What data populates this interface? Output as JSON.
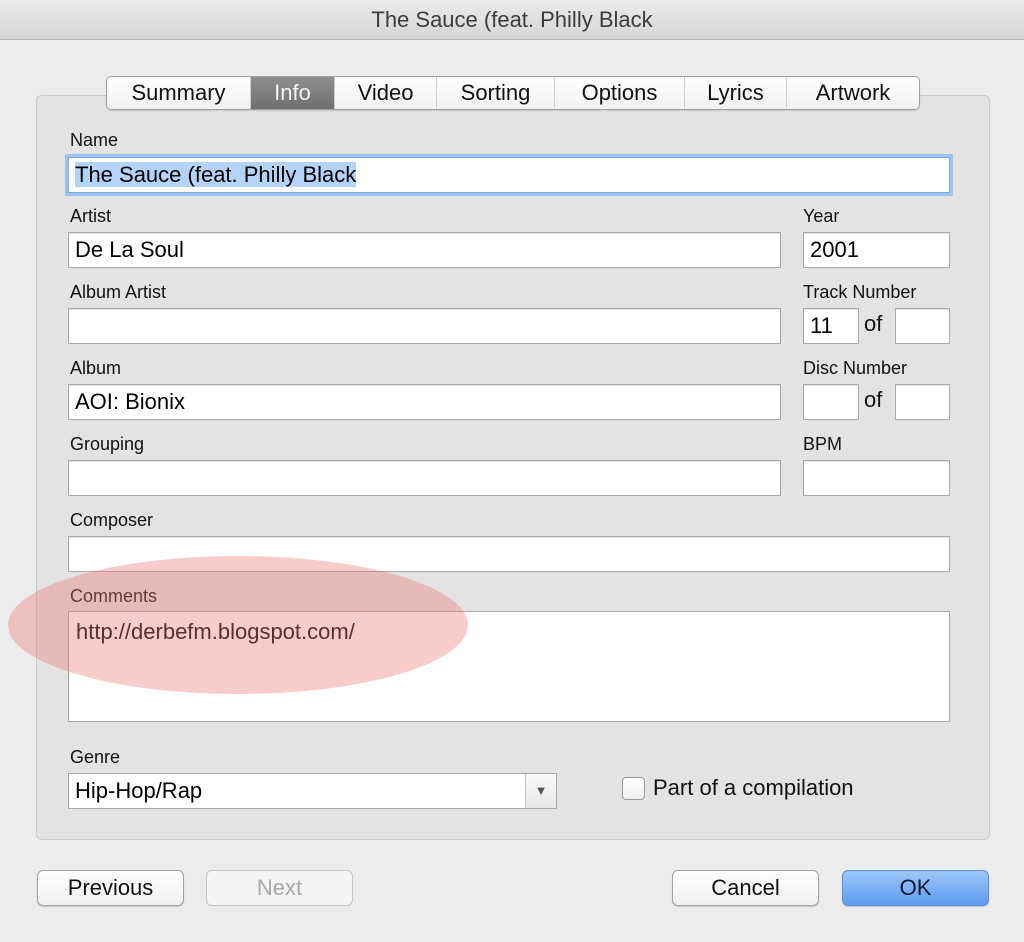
{
  "window": {
    "title": "The Sauce (feat. Philly Black"
  },
  "tabs": [
    {
      "label": "Summary",
      "active": false
    },
    {
      "label": "Info",
      "active": true
    },
    {
      "label": "Video",
      "active": false
    },
    {
      "label": "Sorting",
      "active": false
    },
    {
      "label": "Options",
      "active": false
    },
    {
      "label": "Lyrics",
      "active": false
    },
    {
      "label": "Artwork",
      "active": false
    }
  ],
  "fields": {
    "name": {
      "label": "Name",
      "value": "The Sauce (feat. Philly Black"
    },
    "artist": {
      "label": "Artist",
      "value": "De La Soul"
    },
    "year": {
      "label": "Year",
      "value": "2001"
    },
    "album_artist": {
      "label": "Album Artist",
      "value": ""
    },
    "track_number": {
      "label": "Track Number",
      "value": "11",
      "of_label": "of",
      "of_value": ""
    },
    "album": {
      "label": "Album",
      "value": "AOI: Bionix"
    },
    "disc_number": {
      "label": "Disc Number",
      "value": "",
      "of_label": "of",
      "of_value": ""
    },
    "grouping": {
      "label": "Grouping",
      "value": ""
    },
    "bpm": {
      "label": "BPM",
      "value": ""
    },
    "composer": {
      "label": "Composer",
      "value": ""
    },
    "comments": {
      "label": "Comments",
      "value": "http://derbefm.blogspot.com/"
    },
    "genre": {
      "label": "Genre",
      "value": "Hip-Hop/Rap"
    },
    "compilation": {
      "label": "Part of a compilation",
      "checked": false
    }
  },
  "buttons": {
    "previous": "Previous",
    "next": "Next",
    "cancel": "Cancel",
    "ok": "OK"
  },
  "icons": {
    "dropdown": "chevron-down-icon"
  },
  "colors": {
    "accent": "#5c9bf0",
    "selection": "#b4d3f9",
    "highlight": "#f07878"
  }
}
